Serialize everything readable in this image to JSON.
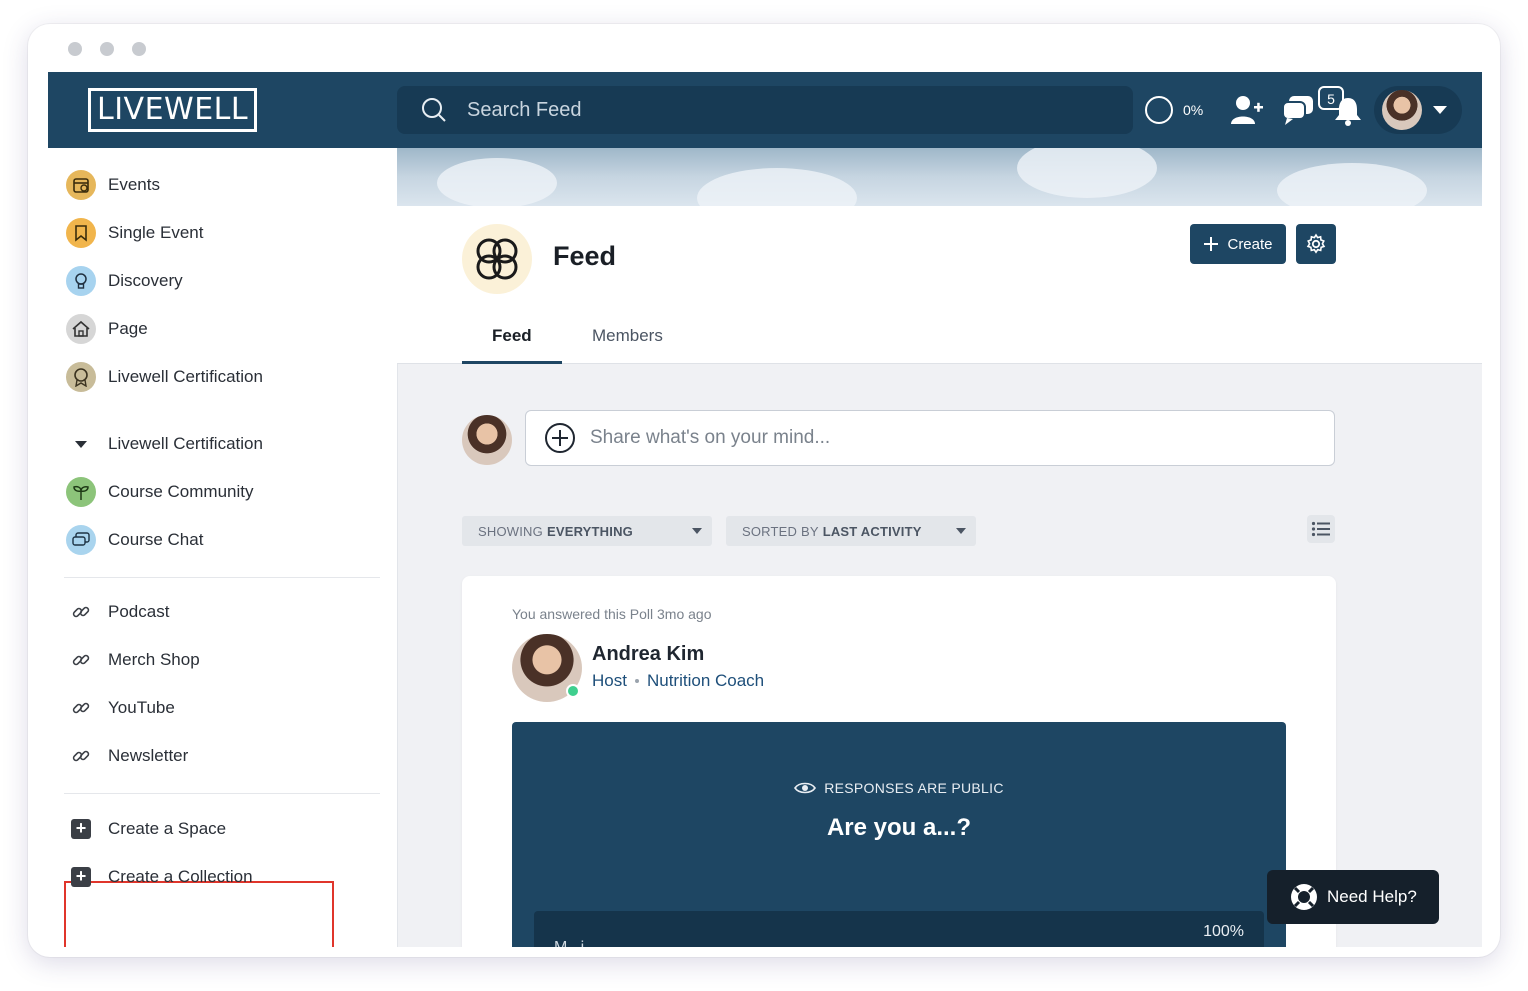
{
  "header": {
    "logo_text": "LIVEWELL",
    "search_placeholder": "Search Feed",
    "progress_label": "0%",
    "progress_value": 0,
    "notifications_count": "5"
  },
  "sidebar": {
    "items": [
      {
        "label": "Events",
        "icon": "calendar-icon",
        "color": "#e6b75b"
      },
      {
        "label": "Single Event",
        "icon": "bookmark-icon",
        "color": "#f1b54c"
      },
      {
        "label": "Discovery",
        "icon": "lightbulb-icon",
        "color": "#a7d3ef"
      },
      {
        "label": "Page",
        "icon": "house-icon",
        "color": "#c9c9c9"
      },
      {
        "label": "Livewell Certification",
        "icon": "award-icon",
        "color": "#b8ab8a"
      }
    ],
    "collection": {
      "label": "Livewell Certification",
      "items": [
        {
          "label": "Course Community",
          "icon": "sprout-icon",
          "color": "#8cc47a"
        },
        {
          "label": "Course Chat",
          "icon": "chat-icon",
          "color": "#a9d4ee"
        }
      ]
    },
    "links": [
      {
        "label": "Podcast"
      },
      {
        "label": "Merch Shop"
      },
      {
        "label": "YouTube"
      },
      {
        "label": "Newsletter"
      }
    ],
    "actions": {
      "create_space": "Create a Space",
      "create_collection": "Create a Collection"
    }
  },
  "space": {
    "title": "Feed",
    "create_label": "Create",
    "tabs": [
      {
        "label": "Feed",
        "active": true
      },
      {
        "label": "Members",
        "active": false
      }
    ]
  },
  "composer": {
    "placeholder": "Share what's on your mind..."
  },
  "filters": {
    "showing_prefix": "SHOWING",
    "showing_value": "EVERYTHING",
    "sorted_prefix": "SORTED BY",
    "sorted_value": "LAST ACTIVITY"
  },
  "post": {
    "meta": "You answered this Poll 3mo ago",
    "author": "Andrea Kim",
    "role1": "Host",
    "role2": "Nutrition Coach",
    "poll": {
      "visibility": "RESPONSES ARE PUBLIC",
      "question": "Are you a...?",
      "option_label": "M...i...",
      "option_percent": "100%"
    }
  },
  "help": {
    "label": "Need Help?"
  },
  "colors": {
    "brand": "#1e4663",
    "highlight": "#e0352b",
    "online": "#3fcf8e"
  }
}
